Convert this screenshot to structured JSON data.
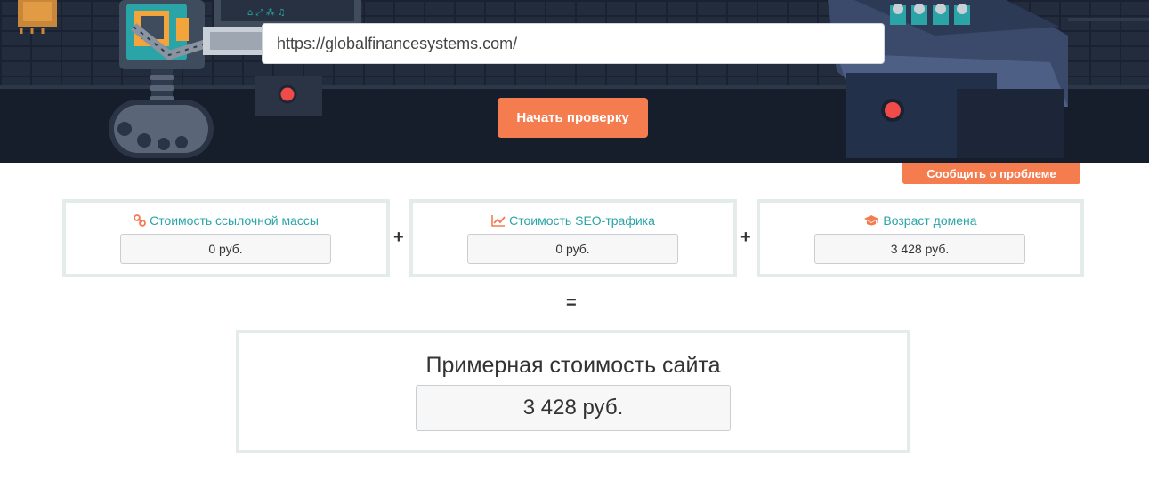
{
  "header": {
    "url_value": "https://globalfinancesystems.com/",
    "check_button": "Начать проверку",
    "report_button": "Сообщить о проблеме"
  },
  "metrics": [
    {
      "title": "Стоимость ссылочной массы",
      "value": "0 руб.",
      "icon": "link-icon"
    },
    {
      "title": "Стоимость SEO-трафика",
      "value": "0 руб.",
      "icon": "line-chart-icon"
    },
    {
      "title": "Возраст домена",
      "value": "3 428 руб.",
      "icon": "graduation-cap-icon"
    }
  ],
  "operators": {
    "plus": "+",
    "equals": "="
  },
  "total": {
    "title": "Примерная стоимость сайта",
    "value": "3 428 руб."
  },
  "colors": {
    "accent": "#f47c4f",
    "teal": "#2aa4a6",
    "hero_bg": "#1b2434",
    "card_border": "#e4ecea"
  }
}
